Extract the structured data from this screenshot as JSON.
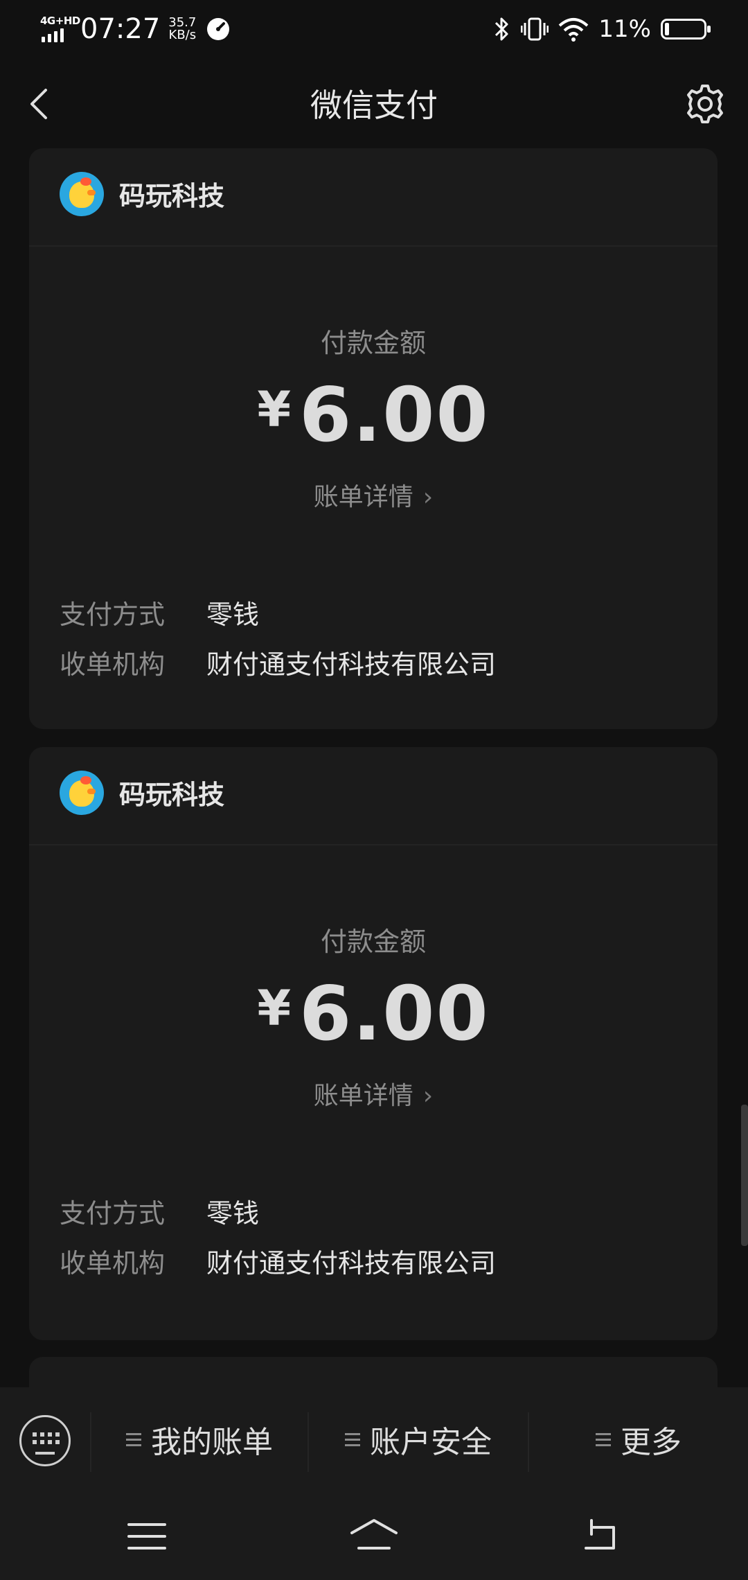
{
  "status_bar": {
    "network": "4G+HD",
    "time": "07:27",
    "speed_value": "35.7",
    "speed_unit": "KB/s",
    "battery": "11%",
    "battery_level": 0.11,
    "icons": [
      "signal-icon",
      "speedometer-icon",
      "bluetooth-icon",
      "vibrate-icon",
      "wifi-icon",
      "battery-icon"
    ]
  },
  "header": {
    "title": "微信支付",
    "back_icon": "chevron-left-icon",
    "settings_icon": "gear-icon"
  },
  "payments": [
    {
      "merchant": "码玩科技",
      "amount_label": "付款金额",
      "currency": "¥",
      "amount": "6.00",
      "detail_link": "账单详情",
      "method_label": "支付方式",
      "method_value": "零钱",
      "acquirer_label": "收单机构",
      "acquirer_value": "财付通支付科技有限公司"
    },
    {
      "merchant": "码玩科技",
      "amount_label": "付款金额",
      "currency": "¥",
      "amount": "6.00",
      "detail_link": "账单详情",
      "method_label": "支付方式",
      "method_value": "零钱",
      "acquirer_label": "收单机构",
      "acquirer_value": "财付通支付科技有限公司"
    }
  ],
  "menu": {
    "keyboard_icon": "keyboard-icon",
    "items": [
      {
        "label": "我的账单",
        "icon": "menu-lines-icon"
      },
      {
        "label": "账户安全",
        "icon": "menu-lines-icon"
      },
      {
        "label": "更多",
        "icon": "menu-lines-icon"
      }
    ]
  },
  "nav": {
    "icons": [
      "recents-icon",
      "home-icon",
      "back-icon"
    ]
  },
  "colors": {
    "background": "#111111",
    "card": "#1b1b1b",
    "primary_text": "#e6e6e6",
    "secondary_text": "#8d8d8d"
  }
}
